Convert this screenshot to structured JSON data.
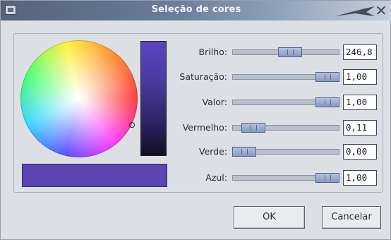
{
  "window": {
    "title": "Seleção de cores"
  },
  "colors": {
    "selected_swatch": "#5c45b4"
  },
  "icons": {
    "window_menu": "window-menu-icon",
    "close": "close-icon"
  },
  "sliders": [
    {
      "label": "Brilho:",
      "value": "246,8",
      "level": 0.55
    },
    {
      "label": "Saturação:",
      "value": "1,00",
      "level": 1.0
    },
    {
      "label": "Valor:",
      "value": "1,00",
      "level": 1.0
    },
    {
      "label": "Vermelho:",
      "value": "0,11",
      "level": 0.11
    },
    {
      "label": "Verde:",
      "value": "0,00",
      "level": 0.0
    },
    {
      "label": "Azul:",
      "value": "1,00",
      "level": 1.0
    }
  ],
  "buttons": {
    "ok": "OK",
    "cancel": "Cancelar"
  }
}
